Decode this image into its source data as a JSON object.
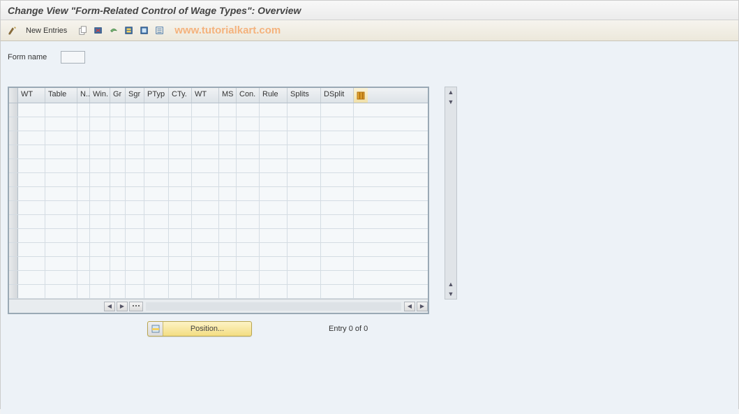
{
  "title": "Change View \"Form-Related Control of Wage Types\": Overview",
  "toolbar": {
    "new_entries": "New Entries"
  },
  "watermark": "www.tutorialkart.com",
  "form": {
    "name_label": "Form name",
    "name_value": ""
  },
  "grid": {
    "columns": [
      "WT",
      "Table",
      "N..",
      "Win.",
      "Gr",
      "Sgr",
      "PTyp",
      "CTy.",
      "WT",
      "MS",
      "Con.",
      "Rule",
      "Splits",
      "DSplit"
    ],
    "row_count": 14
  },
  "footer": {
    "position_label": "Position...",
    "entry_text": "Entry 0 of 0"
  }
}
